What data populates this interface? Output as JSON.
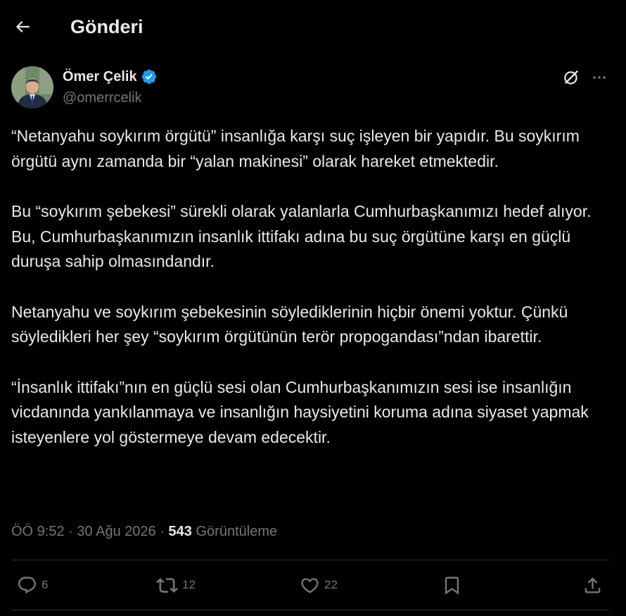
{
  "header": {
    "title": "Gönderi"
  },
  "author": {
    "display_name": "Ömer Çelik",
    "handle": "@omerrcelik",
    "verified_color": "#1d9bf0"
  },
  "tweet": {
    "paragraphs": [
      "“Netanyahu soykırım örgütü” insanlığa karşı suç işleyen bir yapıdır. Bu soykırım örgütü aynı zamanda bir “yalan makinesi” olarak hareket etmektedir.",
      "Bu “soykırım şebekesi” sürekli olarak yalanlarla Cumhurbaşkanımızı hedef alıyor. Bu, Cumhurbaşkanımızın insanlık ittifakı adına bu suç örgütüne karşı en güçlü duruşa sahip olmasındandır.",
      "Netanyahu ve soykırım şebekesinin söylediklerinin hiçbir önemi yoktur. Çünkü söyledikleri her şey “soykırım örgütünün terör propogandası”ndan ibarettir.",
      "“İnsanlık ittifakı”nın en güçlü sesi olan Cumhurbaşkanımızın sesi ise insanlığın vicdanında yankılanmaya ve insanlığın haysiyetini koruma adına siyaset yapmak isteyenlere yol göstermeye devam edecektir."
    ]
  },
  "meta": {
    "time": "ÖÖ 9:52",
    "date": "30 Ağu 2026",
    "separator": "·",
    "views_count": "543",
    "views_label": "Görüntüleme"
  },
  "actions": {
    "replies": "6",
    "reposts": "12",
    "likes": "22"
  },
  "icons": {
    "back": "arrow-left-icon",
    "verified": "verified-badge-icon",
    "grok": "grok-icon",
    "more": "more-dots-icon",
    "reply": "reply-icon",
    "repost": "repost-icon",
    "like": "heart-icon",
    "bookmark": "bookmark-icon",
    "share": "share-icon"
  },
  "colors": {
    "background": "#000000",
    "text": "#e7e9ea",
    "secondary": "#71767b",
    "divider": "#2f3336",
    "accent": "#1d9bf0"
  }
}
